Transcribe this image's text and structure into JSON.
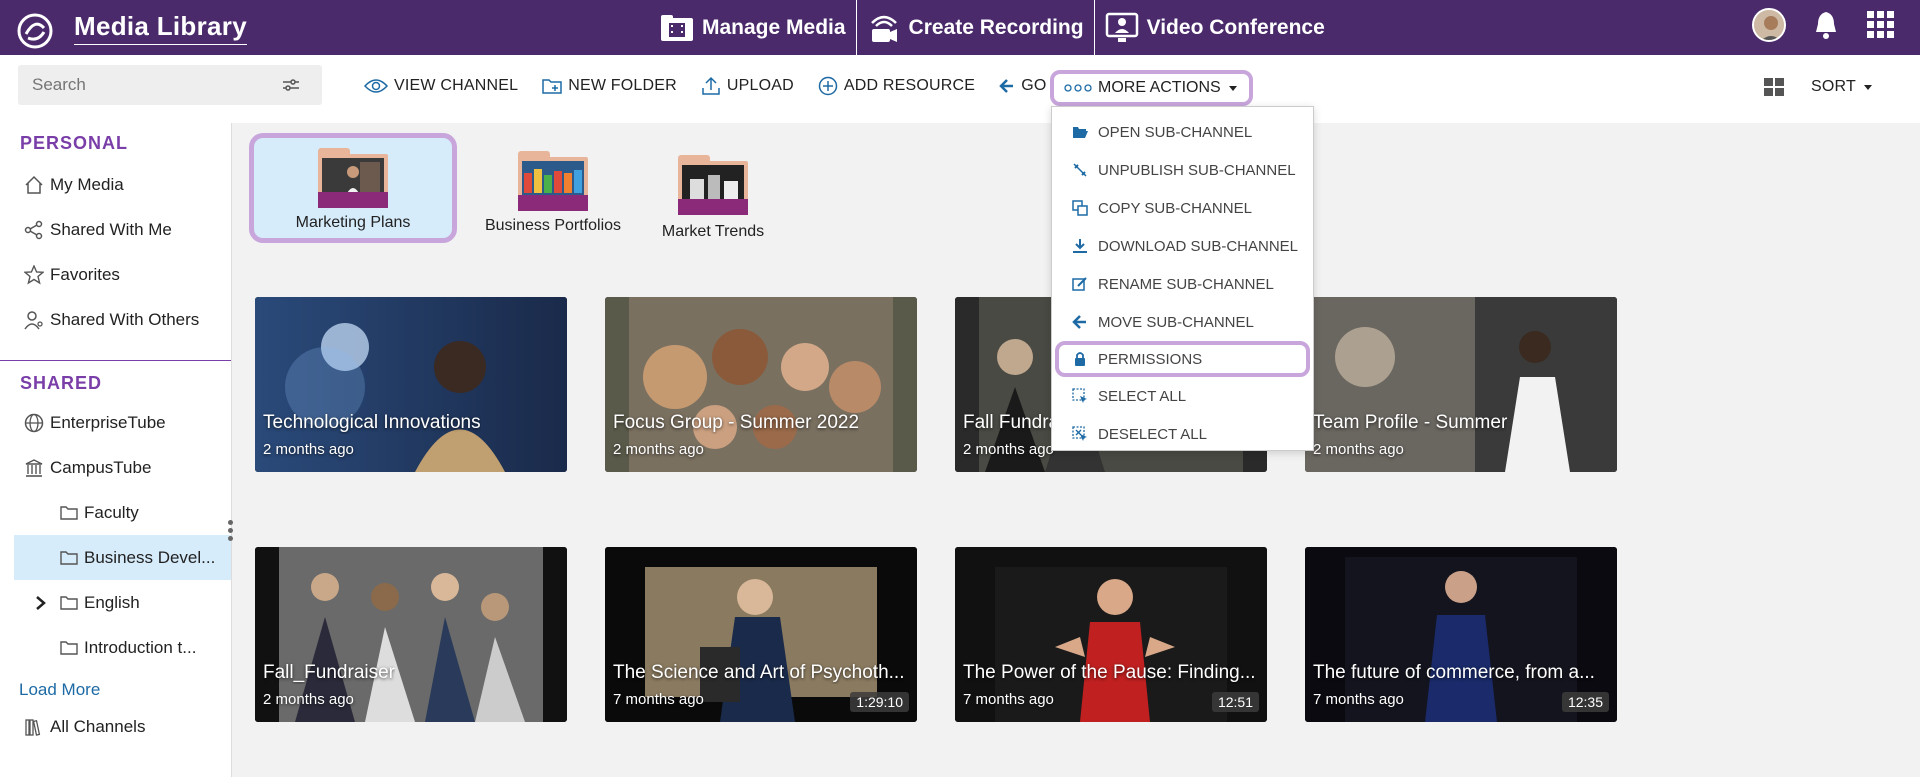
{
  "header": {
    "app_title": "Media Library",
    "nav": [
      {
        "label": "Manage Media",
        "icon": "folder-film-icon"
      },
      {
        "label": "Create Recording",
        "icon": "camera-broadcast-icon"
      },
      {
        "label": "Video Conference",
        "icon": "video-conference-icon"
      }
    ]
  },
  "search": {
    "placeholder": "Search"
  },
  "toolbar": {
    "view_channel": "VIEW CHANNEL",
    "new_folder": "NEW FOLDER",
    "upload": "UPLOAD",
    "add_resource": "ADD RESOURCE",
    "go_back": "GO BACK",
    "more_actions": "MORE ACTIONS",
    "sort": "SORT"
  },
  "sidebar": {
    "personal_heading": "PERSONAL",
    "personal_items": [
      "My Media",
      "Shared With Me",
      "Favorites",
      "Shared With Others"
    ],
    "shared_heading": "SHARED",
    "shared_items": [
      "EnterpriseTube",
      "CampusTube"
    ],
    "sub_items": [
      "Faculty",
      "Business Devel...",
      "English",
      "Introduction t..."
    ],
    "load_more": "Load More",
    "all_channels": "All Channels"
  },
  "folders": [
    {
      "label": "Marketing Plans",
      "selected": true
    },
    {
      "label": "Business Portfolios",
      "selected": false
    },
    {
      "label": "Market Trends",
      "selected": false
    }
  ],
  "videos": [
    {
      "title": "Technological Innovations",
      "age": "2 months ago",
      "duration": ""
    },
    {
      "title": "Focus Group - Summer 2022",
      "age": "2 months ago",
      "duration": ""
    },
    {
      "title": "Fall Fundra",
      "age": "2 months ago",
      "duration": ""
    },
    {
      "title": "Team Profile - Summer",
      "age": "2 months ago",
      "duration": ""
    },
    {
      "title": "Fall_Fundraiser",
      "age": "2 months ago",
      "duration": ""
    },
    {
      "title": "The Science and Art of Psychoth...",
      "age": "7 months ago",
      "duration": "1:29:10"
    },
    {
      "title": "The Power of the Pause: Finding...",
      "age": "7 months ago",
      "duration": "12:51"
    },
    {
      "title": "The future of commerce, from a...",
      "age": "7 months ago",
      "duration": "12:35"
    }
  ],
  "dropdown": {
    "items": [
      "OPEN SUB-CHANNEL",
      "UNPUBLISH SUB-CHANNEL",
      "COPY SUB-CHANNEL",
      "DOWNLOAD SUB-CHANNEL",
      "RENAME SUB-CHANNEL",
      "MOVE SUB-CHANNEL",
      "PERMISSIONS",
      "SELECT ALL",
      "DESELECT ALL"
    ],
    "highlighted": "PERMISSIONS"
  },
  "colors": {
    "brand": "#4a2a6b",
    "accent": "#7a3ea8",
    "highlight": "#c8a6dc",
    "selected_bg": "#d6ecfb",
    "link": "#1d6aa5"
  }
}
